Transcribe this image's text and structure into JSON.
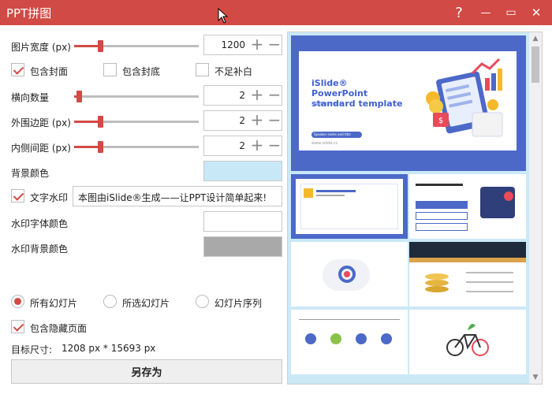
{
  "window": {
    "title": "PPT拼图",
    "help_label": "?",
    "minimize_label": "—",
    "maximize_label": "▭",
    "close_label": "✕"
  },
  "settings": {
    "image_width_label": "图片宽度 (px)",
    "image_width_value": "1200",
    "include_cover_label": "包含封面",
    "include_cover_checked": true,
    "include_back_label": "包含封底",
    "include_back_checked": false,
    "fill_gap_label": "不足补白",
    "fill_gap_checked": false,
    "horizontal_count_label": "横向数量",
    "horizontal_count_value": "2",
    "outer_margin_label": "外围边距 (px)",
    "outer_margin_value": "2",
    "inner_spacing_label": "内侧间距 (px)",
    "inner_spacing_value": "2",
    "bg_color_label": "背景颜色",
    "bg_color": "#c8e8f8",
    "watermark_label": "文字水印",
    "watermark_checked": true,
    "watermark_text": "本图由iSlide®生成——让PPT设计简单起来!",
    "watermark_font_color_label": "水印字体颜色",
    "watermark_font_color": "#ffffff",
    "watermark_bg_color_label": "水印背景颜色",
    "watermark_bg_color": "#a9a9a9"
  },
  "scope": {
    "all_slides_label": "所有幻灯片",
    "selected_slides_label": "所选幻灯片",
    "slide_sequence_label": "幻灯片序列",
    "selected": "all",
    "include_hidden_label": "包含隐藏页面",
    "include_hidden_checked": true
  },
  "target_size_label": "目标尺寸:",
  "target_size_value": "1208 px *  15693 px",
  "save_as_label": "另存为",
  "preview": {
    "cover_title": "iSlide® PowerPoint standard template",
    "cover_subtitle": "Subtitle here",
    "cover_speaker": "Speaker name and title",
    "cover_url": "www.islide.cc"
  },
  "colors": {
    "accent": "#d24a45",
    "preview_bg": "#cbe9f7",
    "slide_blue": "#4c69c8"
  },
  "icons": {
    "plus": "plus-icon",
    "minus": "minus-icon",
    "scroll_up": "chevron-up-icon",
    "scroll_down": "chevron-down-icon"
  },
  "sliders": {
    "image_width": 0.2,
    "horizontal_count": 0.02,
    "outer_margin": 0.2,
    "inner_spacing": 0.2
  }
}
